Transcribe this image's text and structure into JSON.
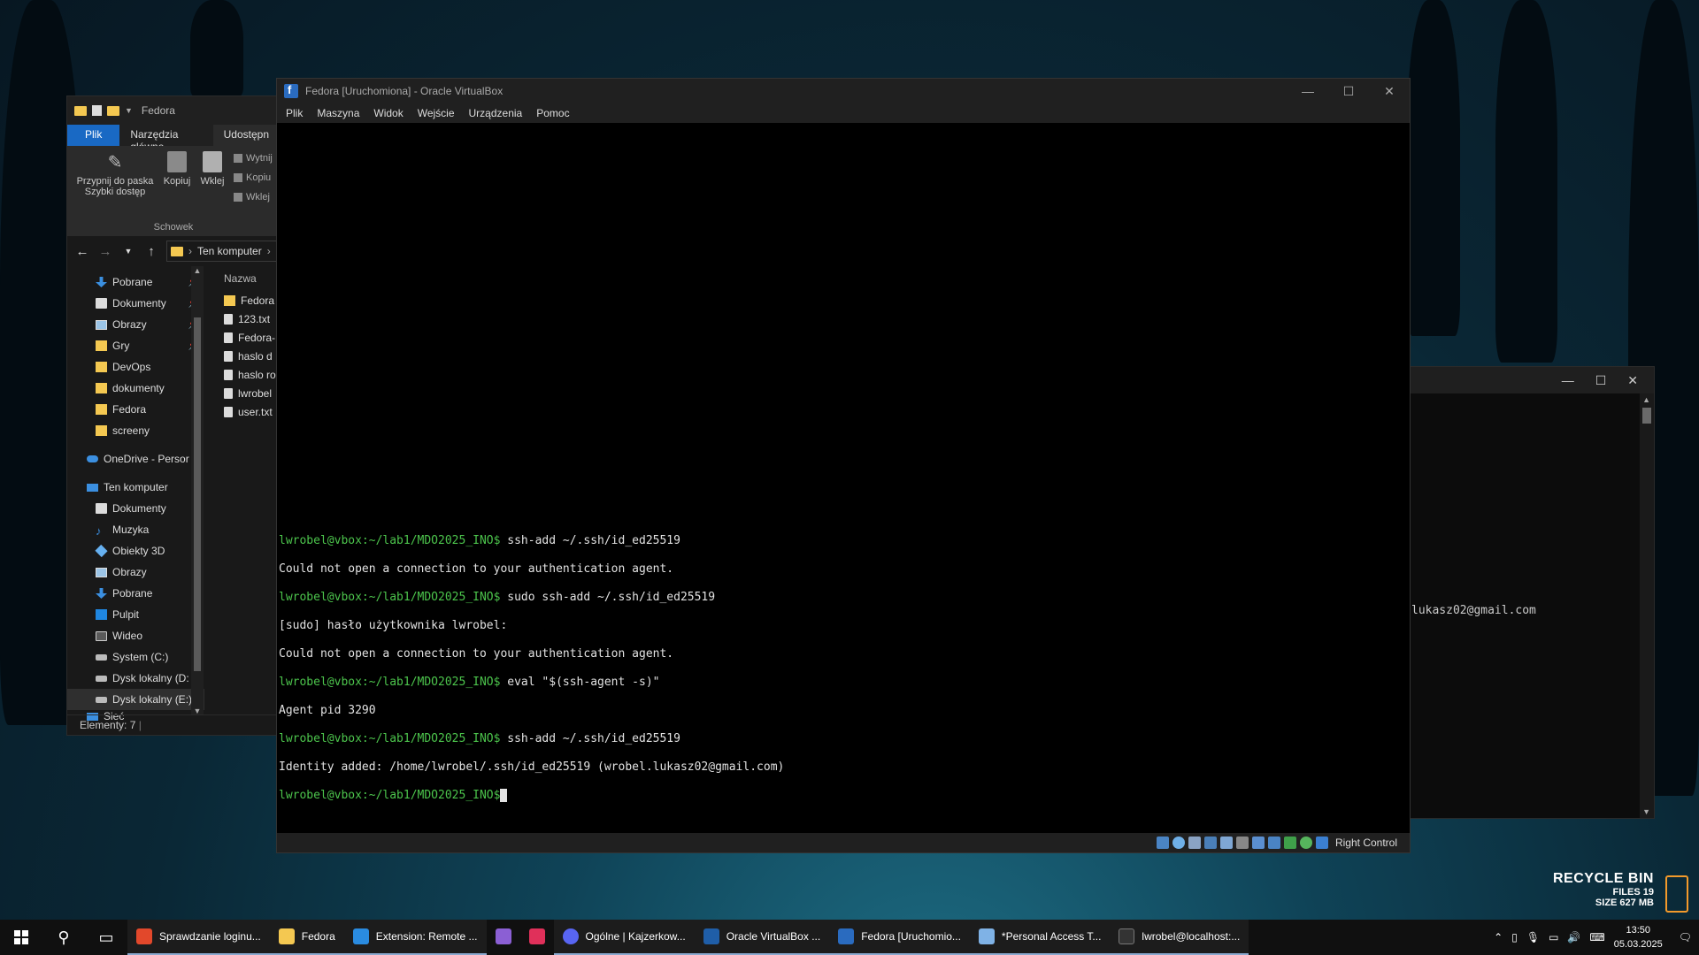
{
  "explorer": {
    "title": "Fedora",
    "tabs": [
      "Plik",
      "Narzędzia główne",
      "Udostępn"
    ],
    "ribbon": {
      "pin_label_1": "Przypnij do paska",
      "pin_label_2": "Szybki dostęp",
      "copy_label": "Kopiuj",
      "paste_label": "Wklej",
      "small": [
        "Wytnij",
        "Kopiu",
        "Wklej"
      ],
      "group_label": "Schowek"
    },
    "address": "Ten komputer",
    "nav": [
      {
        "label": "Pobrane",
        "icon": "download-icon",
        "pinned": true
      },
      {
        "label": "Dokumenty",
        "icon": "document-icon",
        "pinned": true
      },
      {
        "label": "Obrazy",
        "icon": "pictures-icon",
        "pinned": true
      },
      {
        "label": "Gry",
        "icon": "folder-icon",
        "pinned": true
      },
      {
        "label": "DevOps",
        "icon": "folder-icon"
      },
      {
        "label": "dokumenty",
        "icon": "folder-icon"
      },
      {
        "label": "Fedora",
        "icon": "folder-icon"
      },
      {
        "label": "screeny",
        "icon": "folder-icon"
      }
    ],
    "onedrive": "OneDrive - Persor",
    "this_pc": "Ten komputer",
    "pc_items": [
      {
        "label": "Dokumenty",
        "icon": "document-icon"
      },
      {
        "label": "Muzyka",
        "icon": "music-icon"
      },
      {
        "label": "Obiekty 3D",
        "icon": "objects-3d-icon"
      },
      {
        "label": "Obrazy",
        "icon": "pictures-icon"
      },
      {
        "label": "Pobrane",
        "icon": "download-icon"
      },
      {
        "label": "Pulpit",
        "icon": "desktop-icon"
      },
      {
        "label": "Wideo",
        "icon": "video-icon"
      },
      {
        "label": "System (C:)",
        "icon": "drive-icon"
      },
      {
        "label": "Dysk lokalny (D:",
        "icon": "drive-icon"
      },
      {
        "label": "Dysk lokalny (E:)",
        "icon": "drive-icon"
      }
    ],
    "network": "Sieć",
    "column_header": "Nazwa",
    "files": [
      {
        "name": "Fedora",
        "type": "folder"
      },
      {
        "name": "123.txt",
        "type": "file"
      },
      {
        "name": "Fedora-",
        "type": "file"
      },
      {
        "name": "haslo d",
        "type": "file"
      },
      {
        "name": "haslo ro",
        "type": "file"
      },
      {
        "name": "lwrobel",
        "type": "file"
      },
      {
        "name": "user.txt",
        "type": "file"
      }
    ],
    "status": "Elementy: 7"
  },
  "bgterm": {
    "text": "lukasz02@gmail.com"
  },
  "vbox": {
    "title": "Fedora [Uruchomiona] - Oracle VirtualBox",
    "menu": [
      "Plik",
      "Maszyna",
      "Widok",
      "Wejście",
      "Urządzenia",
      "Pomoc"
    ],
    "terminal": [
      {
        "prompt": "lwrobel@vbox:~/lab1/MDO2025_INO$",
        "text": " ssh-add ~/.ssh/id_ed25519"
      },
      {
        "prompt": "",
        "text": "Could not open a connection to your authentication agent."
      },
      {
        "prompt": "lwrobel@vbox:~/lab1/MDO2025_INO$",
        "text": " sudo ssh-add ~/.ssh/id_ed25519"
      },
      {
        "prompt": "",
        "text": "[sudo] hasło użytkownika lwrobel:"
      },
      {
        "prompt": "",
        "text": "Could not open a connection to your authentication agent."
      },
      {
        "prompt": "lwrobel@vbox:~/lab1/MDO2025_INO$",
        "text": " eval \"$(ssh-agent -s)\""
      },
      {
        "prompt": "",
        "text": "Agent pid 3290"
      },
      {
        "prompt": "lwrobel@vbox:~/lab1/MDO2025_INO$",
        "text": " ssh-add ~/.ssh/id_ed25519"
      },
      {
        "prompt": "",
        "text": "Identity added: /home/lwrobel/.ssh/id_ed25519 (wrobel.lukasz02@gmail.com)"
      },
      {
        "prompt": "lwrobel@vbox:~/lab1/MDO2025_INO$",
        "text": ""
      }
    ],
    "host_key": "Right Control"
  },
  "recycle_bin": {
    "title": "RECYCLE BIN",
    "files": "FILES 19",
    "size": "SIZE 627 MB"
  },
  "taskbar": {
    "apps": [
      {
        "label": "Sprawdzanie loginu...",
        "icon": "brave-icon",
        "color": "#e2482b",
        "open": true
      },
      {
        "label": "Fedora",
        "icon": "folder-icon",
        "color": "#f4c851",
        "open": true
      },
      {
        "label": "Extension: Remote ...",
        "icon": "vscode-icon",
        "color": "#2a8be0",
        "open": true
      },
      {
        "label": "",
        "icon": "visual-studio-icon",
        "color": "#8b5fd4",
        "open": false
      },
      {
        "label": "",
        "icon": "intellij-icon",
        "color": "#e0305a",
        "open": false
      },
      {
        "label": "Ogólne | Kajzerkow...",
        "icon": "discord-icon",
        "color": "#5865f2",
        "open": true
      },
      {
        "label": "Oracle VirtualBox ...",
        "icon": "virtualbox-icon",
        "color": "#1f5ea8",
        "open": true
      },
      {
        "label": "Fedora [Uruchomio...",
        "icon": "fedora-vm-icon",
        "color": "#2a6bbf",
        "open": true
      },
      {
        "label": "*Personal Access T...",
        "icon": "notepad-icon",
        "color": "#7fb2e6",
        "open": true
      },
      {
        "label": "lwrobel@localhost:...",
        "icon": "terminal-icon",
        "color": "#333333",
        "open": true
      }
    ],
    "time": "13:50",
    "date": "05.03.2025"
  }
}
